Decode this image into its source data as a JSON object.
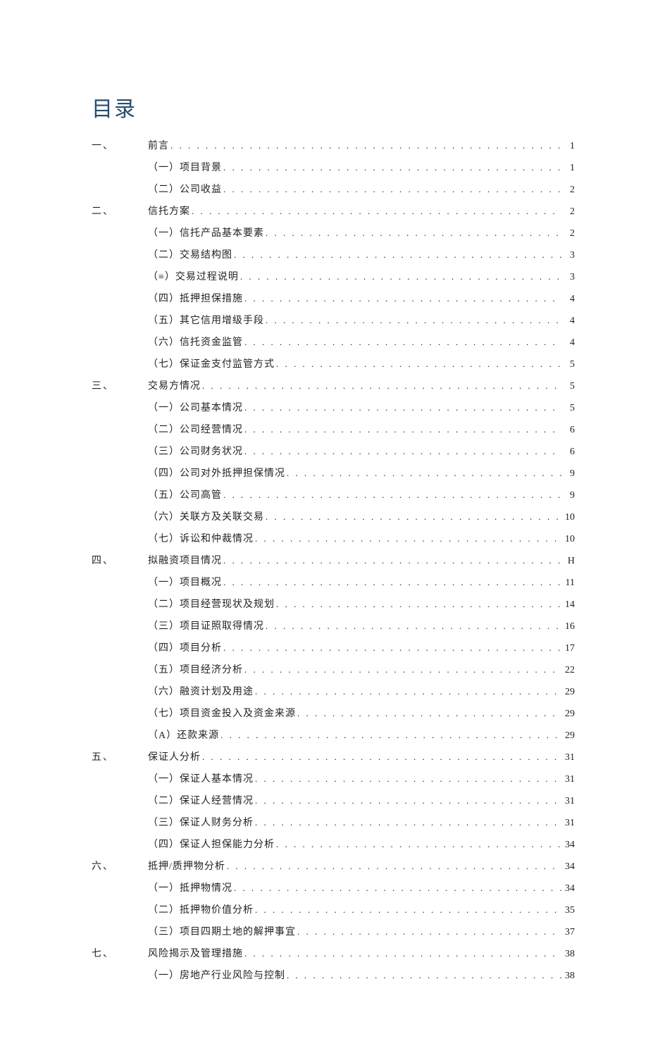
{
  "title": "目录",
  "toc": [
    {
      "level": 0,
      "num": "一、",
      "label": "前言",
      "page": "1"
    },
    {
      "level": 1,
      "num": "",
      "label": "（一）项目背景",
      "page": "1"
    },
    {
      "level": 1,
      "num": "",
      "label": "（二）公司收益",
      "page": "2"
    },
    {
      "level": 0,
      "num": "二、",
      "label": "信托方案",
      "page": "2"
    },
    {
      "level": 1,
      "num": "",
      "label": "（一）信托产品基本要素",
      "page": "2"
    },
    {
      "level": 1,
      "num": "",
      "label": "（二）交易结构图",
      "page": "3"
    },
    {
      "level": 1,
      "num": "",
      "label": "（≡）交易过程说明",
      "page": "3"
    },
    {
      "level": 1,
      "num": "",
      "label": "（四）抵押担保措施",
      "page": "4"
    },
    {
      "level": 1,
      "num": "",
      "label": "（五）其它信用增级手段",
      "page": "4"
    },
    {
      "level": 1,
      "num": "",
      "label": "（六）信托资金监管",
      "page": "4"
    },
    {
      "level": 1,
      "num": "",
      "label": "（七）保证金支付监管方式",
      "page": "5"
    },
    {
      "level": 0,
      "num": "三、",
      "label": "交易方情况",
      "page": "5"
    },
    {
      "level": 1,
      "num": "",
      "label": "（一）公司基本情况",
      "page": "5"
    },
    {
      "level": 1,
      "num": "",
      "label": "（二）公司经营情况",
      "page": "6"
    },
    {
      "level": 1,
      "num": "",
      "label": "（三）公司财务状况",
      "page": "6"
    },
    {
      "level": 1,
      "num": "",
      "label": "（四）公司对外抵押担保情况",
      "page": "9"
    },
    {
      "level": 1,
      "num": "",
      "label": "（五）公司高管",
      "page": "9"
    },
    {
      "level": 1,
      "num": "",
      "label": "（六）关联方及关联交易",
      "page": "10"
    },
    {
      "level": 1,
      "num": "",
      "label": "（七）诉讼和仲裁情况",
      "page": "10"
    },
    {
      "level": 0,
      "num": "四、",
      "label": "拟融资项目情况",
      "page": "H"
    },
    {
      "level": 1,
      "num": "",
      "label": "（一）项目概况",
      "page": "11"
    },
    {
      "level": 1,
      "num": "",
      "label": "（二）项目经营现状及规划",
      "page": "14"
    },
    {
      "level": 1,
      "num": "",
      "label": "（三）项目证照取得情况",
      "page": "16"
    },
    {
      "level": 1,
      "num": "",
      "label": "（四）项目分析",
      "page": "17"
    },
    {
      "level": 1,
      "num": "",
      "label": "（五）项目经济分析",
      "page": "22"
    },
    {
      "level": 1,
      "num": "",
      "label": "（六）融资计划及用途",
      "page": "29"
    },
    {
      "level": 1,
      "num": "",
      "label": "（七）项目资金投入及资金来源",
      "page": "29"
    },
    {
      "level": 1,
      "num": "",
      "label": "（A）还款来源",
      "page": "29"
    },
    {
      "level": 0,
      "num": "五、",
      "label": "保证人分析",
      "page": "31"
    },
    {
      "level": 1,
      "num": "",
      "label": "（一）保证人基本情况",
      "page": "31"
    },
    {
      "level": 1,
      "num": "",
      "label": "（二）保证人经营情况",
      "page": "31"
    },
    {
      "level": 1,
      "num": "",
      "label": "（三）保证人财务分析",
      "page": "31"
    },
    {
      "level": 1,
      "num": "",
      "label": "（四）保证人担保能力分析",
      "page": "34"
    },
    {
      "level": 0,
      "num": "六、",
      "label": "抵押/质押物分析",
      "page": "34"
    },
    {
      "level": 1,
      "num": "",
      "label": "（一）抵押物情况",
      "page": "34"
    },
    {
      "level": 1,
      "num": "",
      "label": "（二）抵押物价值分析",
      "page": "35"
    },
    {
      "level": 1,
      "num": "",
      "label": "（三）项目四期土地的解押事宜",
      "page": "37"
    },
    {
      "level": 0,
      "num": "七、",
      "label": "风险揭示及管理措施",
      "page": "38"
    },
    {
      "level": 1,
      "num": "",
      "label": "（一）房地产行业风险与控制",
      "page": "38"
    }
  ]
}
